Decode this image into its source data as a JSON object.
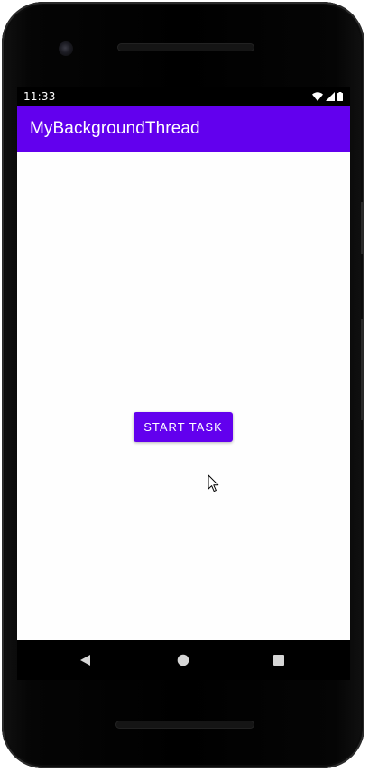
{
  "status_bar": {
    "time": "11:33",
    "icons": [
      "wifi-icon",
      "cellular-signal-icon",
      "battery-icon"
    ]
  },
  "app_bar": {
    "title": "MyBackgroundThread"
  },
  "main": {
    "start_button_label": "START TASK"
  },
  "nav_bar": {
    "buttons": [
      "back",
      "home",
      "recents"
    ]
  },
  "colors": {
    "primary": "#6200ee",
    "on_primary": "#ffffff",
    "background": "#fefefe",
    "status_bar": "#000000"
  }
}
